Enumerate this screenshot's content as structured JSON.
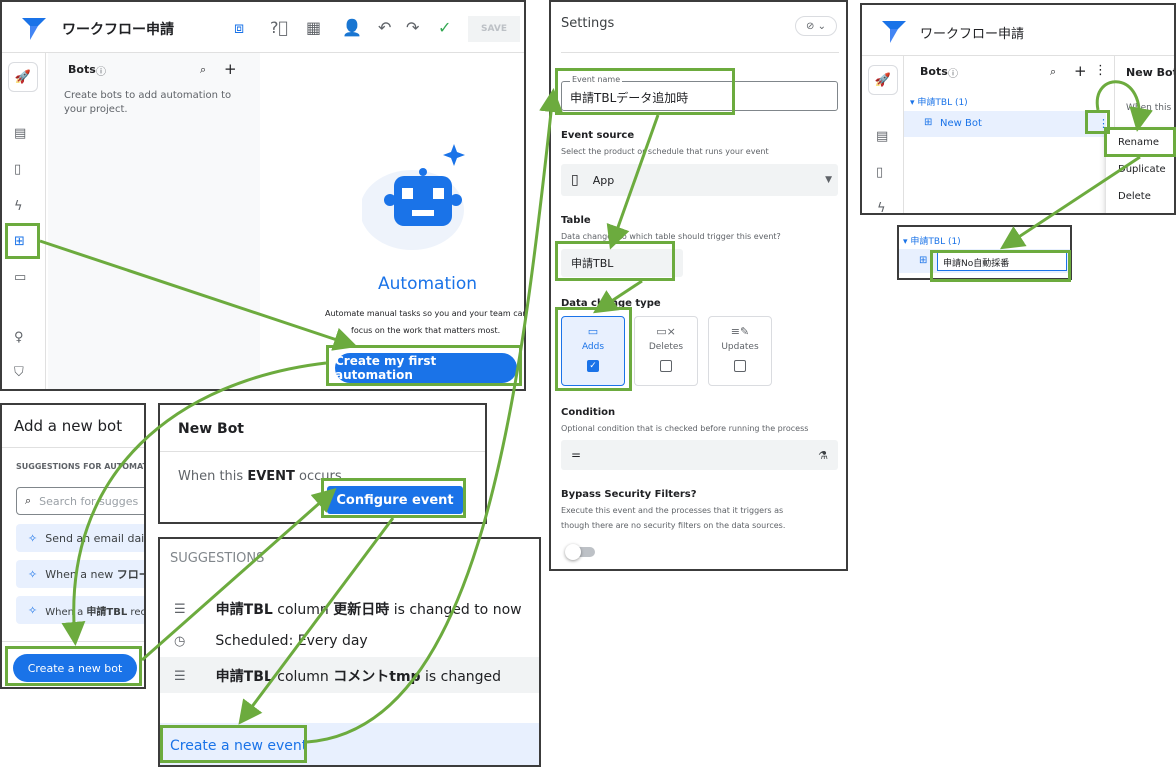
{
  "app": {
    "title": "ワークフロー申請",
    "toolbar_save": "SAVE"
  },
  "bots_panel": {
    "title": "Bots",
    "hint": "Create bots to add automation to your project.",
    "automation_title": "Automation",
    "automation_desc_1": "Automate manual tasks so you and your team can",
    "automation_desc_2": "focus on the work that matters most.",
    "create_first": "Create my first automation"
  },
  "add_bot": {
    "title": "Add a new bot",
    "suggestions_header": "SUGGESTIONS FOR AUTOMATI",
    "search_placeholder": "Search for sugges",
    "suggestion_1": "Send an email daily",
    "suggestion_2_pre": "When a new ",
    "suggestion_2_bold": "フロー",
    "suggestion_3_pre": "When a ",
    "suggestion_3_bold": "申請TBL",
    "suggestion_3_post": " rec",
    "create_bot": "Create a new bot"
  },
  "new_bot": {
    "title": "New Bot",
    "when_pre": "When this ",
    "when_bold": "EVENT",
    "when_post": " occurs",
    "configure": "Configure event"
  },
  "suggestions_panel": {
    "header": "SUGGESTIONS",
    "row1_t1": "申請TBL",
    "row1_t2": " column ",
    "row1_t3": "更新日時",
    "row1_t4": " is changed to now",
    "row2": "Scheduled: Every day",
    "row3_t1": "申請TBL",
    "row3_t2": " column ",
    "row3_t3": "コメントtmp",
    "row3_t4": " is changed",
    "create_event": "Create a new event"
  },
  "settings": {
    "title": "Settings",
    "event_name_label": "Event name",
    "event_name_value": "申請TBLデータ追加時",
    "event_source_label": "Event source",
    "event_source_desc": "Select the product or schedule that runs your event",
    "event_source_value": "App",
    "table_label": "Table",
    "table_desc": "Data changes to which table should trigger this event?",
    "table_value": "申請TBL",
    "data_change_label": "Data change type",
    "adds": "Adds",
    "deletes": "Deletes",
    "updates": "Updates",
    "condition_label": "Condition",
    "condition_desc": "Optional condition that is checked before running the process",
    "condition_value": "=",
    "bypass_label": "Bypass Security Filters?",
    "bypass_desc_1": "Execute this event and the processes that it triggers as",
    "bypass_desc_2": "though there are no security filters on the data sources."
  },
  "tree_panel": {
    "title": "ワークフロー申請",
    "bots": "Bots",
    "new_bot_header": "New Bot",
    "when_this": "When this",
    "group": "申請TBL (1)",
    "item": "New Bot",
    "menu_rename": "Rename",
    "menu_duplicate": "Duplicate",
    "menu_delete": "Delete"
  },
  "rename_panel": {
    "group": "申請TBL (1)",
    "input_value": "申請No自動採番"
  },
  "colors": {
    "accent": "#1a73e8",
    "highlight": "#6cab3e",
    "brand": "#4285f4"
  }
}
